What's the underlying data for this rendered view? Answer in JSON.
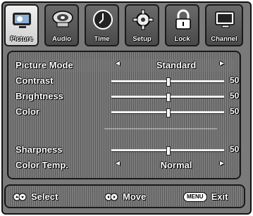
{
  "tabs": [
    {
      "label": "Picture",
      "icon": "picture-icon"
    },
    {
      "label": "Audio",
      "icon": "speaker-icon"
    },
    {
      "label": "Time",
      "icon": "clock-icon"
    },
    {
      "label": "Setup",
      "icon": "gear-icon"
    },
    {
      "label": "Lock",
      "icon": "lock-icon"
    },
    {
      "label": "Channel",
      "icon": "monitor-icon"
    }
  ],
  "picture_menu": {
    "picture_mode": {
      "label": "Picture Mode",
      "value": "Standard"
    },
    "contrast": {
      "label": "Contrast",
      "value": "50",
      "level": 0.5
    },
    "brightness": {
      "label": "Brightness",
      "value": "50",
      "level": 0.5
    },
    "color": {
      "label": "Color",
      "value": "50",
      "level": 0.5
    },
    "sharpness": {
      "label": "Sharpness",
      "value": "50",
      "level": 0.5
    },
    "color_temp": {
      "label": "Color Temp.",
      "value": "Normal"
    },
    "left_arrow": "◄",
    "right_arrow": "►"
  },
  "footer": {
    "select_label": "Select",
    "move_label": "Move",
    "menu_key": "MENU",
    "exit_label": "Exit"
  },
  "colors": {
    "panel": "#7b7b7b",
    "text": "#ffffff",
    "outline": "#111111"
  }
}
